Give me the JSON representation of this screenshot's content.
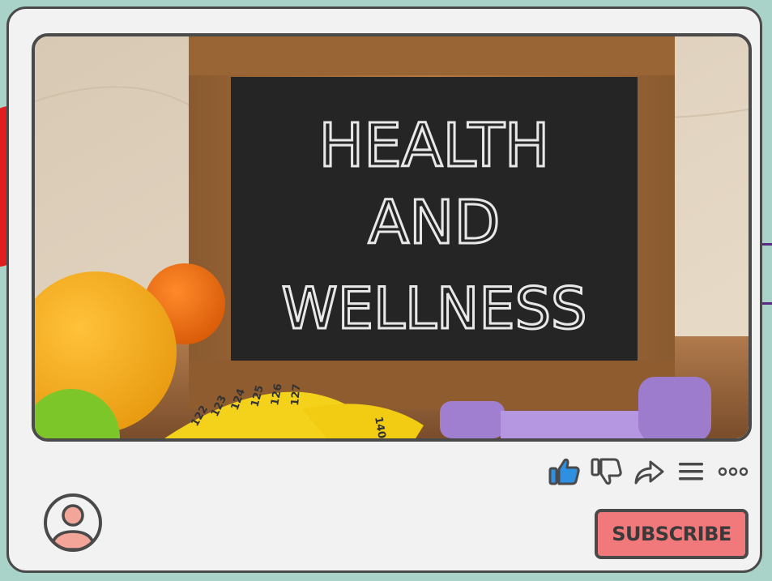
{
  "video": {
    "board_text": [
      "HEALTH",
      "AND",
      "WELLNESS"
    ],
    "tape_numbers": [
      "122",
      "123",
      "124",
      "125",
      "126",
      "127",
      "140"
    ]
  },
  "actions": {
    "like_icon": "thumbs-up-icon",
    "dislike_icon": "thumbs-down-icon",
    "share_icon": "share-arrow-icon",
    "queue_icon": "menu-lines-icon",
    "more_icon": "more-dots-icon"
  },
  "channel": {
    "avatar_icon": "user-avatar-icon",
    "subscribe_label": "SUBSCRIBE"
  },
  "colors": {
    "background": "#a9d3c8",
    "card": "#f2f2f2",
    "outline": "#4a4a4a",
    "like_accent": "#2f8fe0",
    "subscribe": "#f2797b",
    "avatar": "#f3a59a"
  }
}
